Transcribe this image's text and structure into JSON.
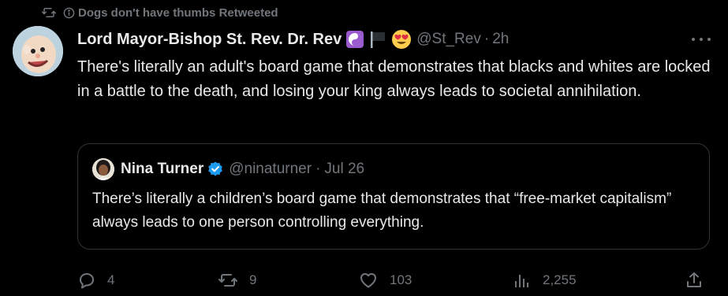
{
  "retweet": {
    "text": "Dogs don't have thumbs Retweeted",
    "icon": "retweet-icon"
  },
  "tweet": {
    "author": {
      "display_name": "Lord Mayor-Bishop St. Rev. Dr. Rev",
      "badges": [
        "yin-yang-emoji",
        "black-flag-emoji",
        "heart-eyes-emoji"
      ],
      "handle": "@St_Rev",
      "separator": "·",
      "time": "2h"
    },
    "text": "There's literally an adult's board game that demonstrates that blacks and whites are locked in a battle to the death, and losing your king always leads to societal annihilation.",
    "quote": {
      "display_name": "Nina Turner",
      "verified": true,
      "handle": "@ninaturner",
      "separator": "·",
      "date": "Jul 26",
      "text": "There’s literally a children’s board game that demonstrates that “free-market capitalism” always leads to one person controlling everything."
    },
    "actions": {
      "replies": "4",
      "retweets": "9",
      "likes": "103",
      "views": "2,255"
    }
  },
  "colors": {
    "background": "#000000",
    "text_primary": "#e7e9ea",
    "text_secondary": "#71767b",
    "border": "#2f3336",
    "verified": "#1d9bf0"
  }
}
